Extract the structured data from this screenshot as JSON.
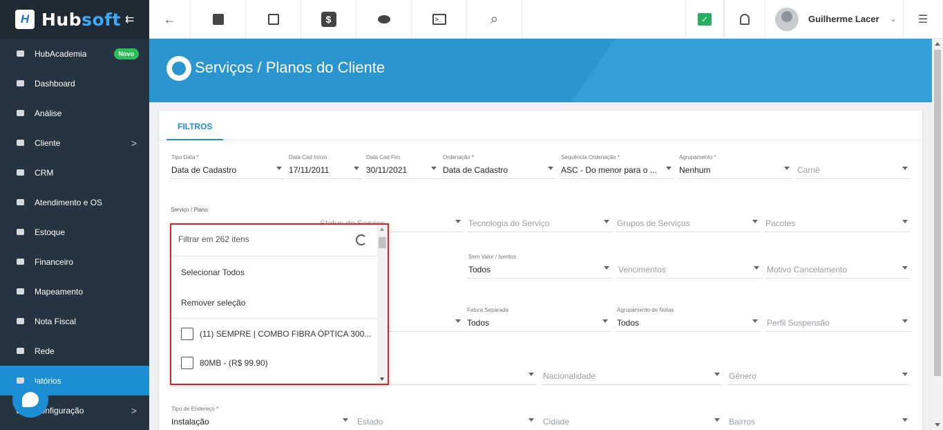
{
  "brand": {
    "part1": "Hub",
    "part2": "soft",
    "mark": "H"
  },
  "sidebar": {
    "items": [
      {
        "label": "HubAcademia",
        "icon": "book-icon",
        "badge": "Novo"
      },
      {
        "label": "Dashboard",
        "icon": "dashboard-icon"
      },
      {
        "label": "Análise",
        "icon": "pie-chart-icon"
      },
      {
        "label": "Cliente",
        "icon": "client-icon",
        "arrow": ">"
      },
      {
        "label": "CRM",
        "icon": "crm-icon"
      },
      {
        "label": "Atendimento e OS",
        "icon": "clock-icon"
      },
      {
        "label": "Estoque",
        "icon": "box-icon"
      },
      {
        "label": "Financeiro",
        "icon": "money-icon"
      },
      {
        "label": "Mapeamento",
        "icon": "map-pin-icon"
      },
      {
        "label": "Nota Fiscal",
        "icon": "invoice-icon"
      },
      {
        "label": "Rede",
        "icon": "network-icon"
      },
      {
        "label": "latórios",
        "icon": "report-icon"
      },
      {
        "label": "Configuração",
        "icon": "gear-icon",
        "arrow": ">"
      }
    ]
  },
  "topbar": {
    "back": "←",
    "dollar": "$",
    "terminal": ">_",
    "search": "⌕",
    "check": "✓",
    "bell": "🔔",
    "user_name": "Guilherme Lacer",
    "user_chevron": "⌄",
    "menu": "☰"
  },
  "page": {
    "title": "Serviços / Planos do Cliente"
  },
  "tabs": {
    "filtros": "FILTROS"
  },
  "filters": {
    "row1": [
      {
        "label": "Tipo Data *",
        "value": "Data de Cadastro"
      },
      {
        "label": "Data Cad Início",
        "value": "17/11/2011"
      },
      {
        "label": "Data Cad Fim",
        "value": "30/11/2021"
      },
      {
        "label": "Ordenação *",
        "value": "Data de Cadastro"
      },
      {
        "label": "Sequência Ordenação *",
        "value": "ASC - Do menor para o ..."
      },
      {
        "label": "Agrupamento *",
        "value": "Nenhum"
      },
      {
        "label": "",
        "placeholder": "Carnê"
      }
    ],
    "servico_label": "Serviço / Plano",
    "row2": [
      {
        "placeholder": "Status do Serviço"
      },
      {
        "placeholder": "Tecnologia do Serviço"
      },
      {
        "placeholder": "Grupos de Serviços"
      },
      {
        "placeholder": "Pacotes"
      }
    ],
    "row3": [
      {
        "label": "",
        "placeholder": ""
      },
      {
        "label": "Sem Valor / Isentos",
        "value": "Todos"
      },
      {
        "placeholder": "Vencimentos"
      },
      {
        "placeholder": "Motivo Cancelamento"
      }
    ],
    "row4": [
      {
        "placeholder": "a"
      },
      {
        "label": "Fatura Separada",
        "value": "Todos"
      },
      {
        "label": "Agrupamento de Notas",
        "value": "Todos"
      },
      {
        "placeholder": "Perfil Suspensão"
      }
    ],
    "row5": [
      {
        "placeholder": "ivil"
      },
      {
        "placeholder": "Nacionalidade"
      },
      {
        "placeholder": "Gênero"
      }
    ],
    "row6": [
      {
        "label": "Tipo de Endereço *",
        "value": "Instalação"
      },
      {
        "placeholder": "Estado"
      },
      {
        "placeholder": "Cidade"
      },
      {
        "placeholder": "Bairros"
      }
    ]
  },
  "dropdown": {
    "filter_placeholder": "Filtrar em 262 itens",
    "select_all": "Selecionar Todos",
    "remove_selection": "Remover seleção",
    "items": [
      {
        "label": "(11) SEMPRE | COMBO FIBRA ÓPTICA 300...",
        "checked": false
      },
      {
        "label": "80MB - (R$ 99.90)",
        "checked": false
      }
    ]
  }
}
